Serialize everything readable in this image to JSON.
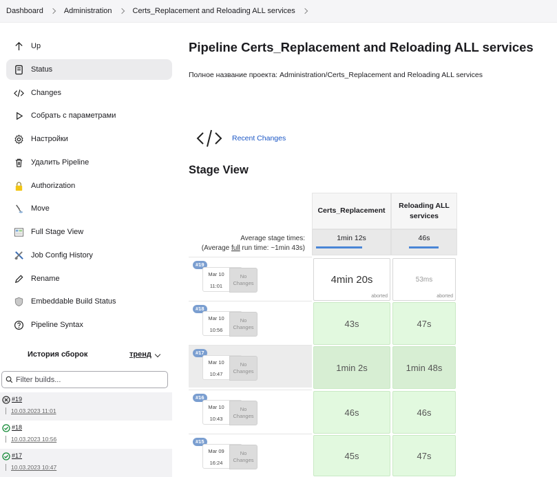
{
  "breadcrumb": [
    "Dashboard",
    "Administration",
    "Certs_Replacement and Reloading ALL services"
  ],
  "sidebar": {
    "items": [
      {
        "label": "Up",
        "icon": "arrow-up-icon"
      },
      {
        "label": "Status",
        "icon": "document-icon"
      },
      {
        "label": "Changes",
        "icon": "code-icon"
      },
      {
        "label": "Собрать с параметрами",
        "icon": "play-icon"
      },
      {
        "label": "Настройки",
        "icon": "gear-icon"
      },
      {
        "label": "Удалить Pipeline",
        "icon": "trash-icon"
      },
      {
        "label": "Authorization",
        "icon": "lock-icon"
      },
      {
        "label": "Move",
        "icon": "move-icon"
      },
      {
        "label": "Full Stage View",
        "icon": "stage-view-icon"
      },
      {
        "label": "Job Config History",
        "icon": "tools-icon"
      },
      {
        "label": "Rename",
        "icon": "pencil-icon"
      },
      {
        "label": "Embeddable Build Status",
        "icon": "shield-icon"
      },
      {
        "label": "Pipeline Syntax",
        "icon": "help-icon"
      }
    ]
  },
  "history": {
    "title": "История сборок",
    "trend_label": "тренд",
    "filter_placeholder": "Filter builds...",
    "builds": [
      {
        "number": "#19",
        "date": "10.03.2023 11:01",
        "status": "aborted"
      },
      {
        "number": "#18",
        "date": "10.03.2023 10:56",
        "status": "success"
      },
      {
        "number": "#17",
        "date": "10.03.2023 10:47",
        "status": "success"
      }
    ]
  },
  "main": {
    "title": "Pipeline Certs_Replacement and Reloading ALL services",
    "full_name": "Полное название проекта: Administration/Certs_Replacement and Reloading ALL services",
    "recent_changes": "Recent Changes",
    "stage_view_title": "Stage View"
  },
  "stage_view": {
    "avg_label_1": "Average stage times:",
    "avg_label_2a": "(Average ",
    "avg_label_2b": "full",
    "avg_label_2c": " run time: ~1min 43s)",
    "stages": [
      {
        "name": "Certs_Replacement",
        "avg": "1min 12s",
        "avg_fill": 0.65
      },
      {
        "name": "Reloading ALL services",
        "avg": "46s",
        "avg_fill": 0.65
      }
    ],
    "no_changes": "No Changes",
    "runs": [
      {
        "num": "#19",
        "date": "Mar 10",
        "time": "11:01",
        "cells": [
          {
            "value": "4min 20s",
            "status": "aborted"
          },
          {
            "value": "53ms",
            "status": "aborted"
          }
        ]
      },
      {
        "num": "#18",
        "date": "Mar 10",
        "time": "10:56",
        "cells": [
          {
            "value": "43s",
            "status": ""
          },
          {
            "value": "47s",
            "status": ""
          }
        ]
      },
      {
        "num": "#17",
        "date": "Mar 10",
        "time": "10:47",
        "cells": [
          {
            "value": "1min 2s",
            "status": ""
          },
          {
            "value": "1min 48s",
            "status": ""
          }
        ]
      },
      {
        "num": "#16",
        "date": "Mar 10",
        "time": "10:43",
        "cells": [
          {
            "value": "46s",
            "status": ""
          },
          {
            "value": "46s",
            "status": ""
          }
        ]
      },
      {
        "num": "#15",
        "date": "Mar 09",
        "time": "16:24",
        "cells": [
          {
            "value": "45s",
            "status": ""
          },
          {
            "value": "47s",
            "status": ""
          }
        ]
      }
    ]
  },
  "colors": {
    "link": "#1a56c5",
    "success": "#138a36",
    "aborted": "#333333",
    "stage_green": "#e2f9df",
    "badge": "#7a9ed0"
  }
}
